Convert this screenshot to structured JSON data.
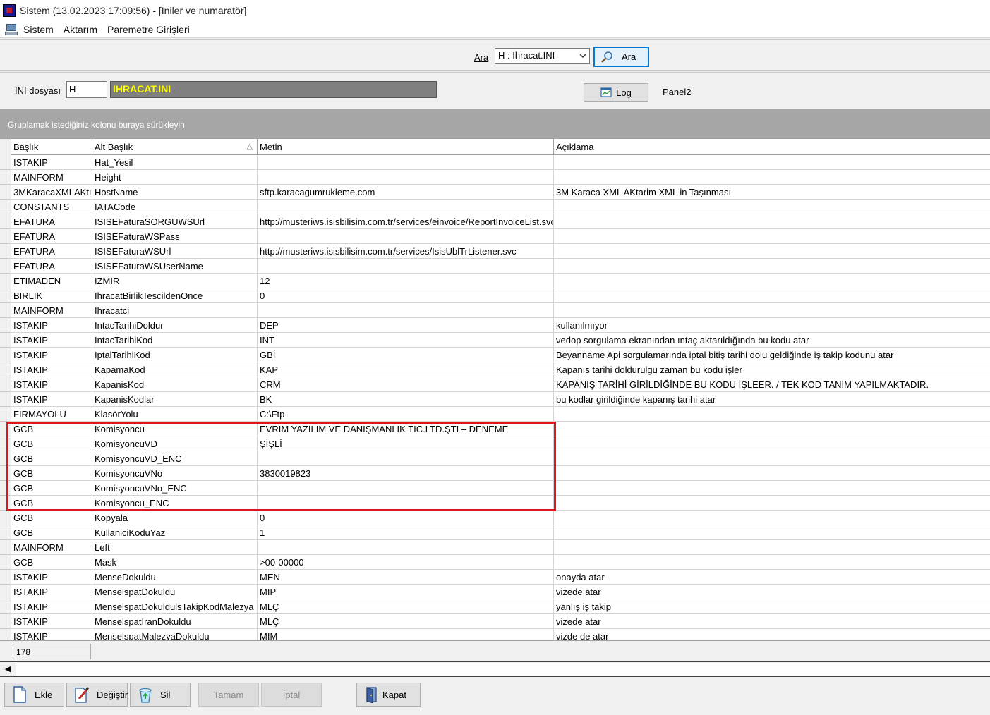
{
  "window": {
    "title": "Sistem (13.02.2023 17:09:56) - [İniler ve numaratör]"
  },
  "menu": {
    "items": [
      "Sistem",
      "Aktarım",
      "Paremetre Girişleri"
    ]
  },
  "search": {
    "label": "Ara",
    "combo_value": "H : İhracat.INI",
    "button_label": "Ara"
  },
  "ini": {
    "label": "INI dosyası",
    "code": "H",
    "filename": "IHRACAT.INI",
    "log_label": "Log",
    "panel_label": "Panel2"
  },
  "grid": {
    "group_hint": "Gruplamak istediğiniz kolonu buraya sürükleyin",
    "columns": [
      "Başlık",
      "Alt Başlık",
      "Metin",
      "Açıklama"
    ],
    "sort_indicator": "△",
    "rows": [
      [
        "ISTAKIP",
        "Hat_Yesil",
        "",
        ""
      ],
      [
        "MAINFORM",
        "Height",
        "",
        ""
      ],
      [
        "3MKaracaXMLAKtı",
        "HostName",
        "sftp.karacagumrukleme.com",
        "3M Karaca XML AKtarim XML in Taşınması"
      ],
      [
        "CONSTANTS",
        "IATACode",
        "",
        ""
      ],
      [
        "EFATURA",
        "ISISEFaturaSORGUWSUrl",
        "http://musteriws.isisbilisim.com.tr/services/einvoice/ReportInvoiceList.svc",
        ""
      ],
      [
        "EFATURA",
        "ISISEFaturaWSPass",
        "",
        ""
      ],
      [
        "EFATURA",
        "ISISEFaturaWSUrl",
        "http://musteriws.isisbilisim.com.tr/services/IsisUblTrListener.svc",
        ""
      ],
      [
        "EFATURA",
        "ISISEFaturaWSUserName",
        "",
        ""
      ],
      [
        "ETIMADEN",
        "IZMIR",
        "12",
        ""
      ],
      [
        "BIRLIK",
        "IhracatBirlikTescildenOnce",
        "0",
        ""
      ],
      [
        "MAINFORM",
        "Ihracatci",
        "",
        ""
      ],
      [
        "ISTAKIP",
        "IntacTarihiDoldur",
        "DEP",
        "kullanılmıyor"
      ],
      [
        "ISTAKIP",
        "IntacTarihiKod",
        "INT",
        "vedop sorgulama ekranından ıntaç aktarıldığında bu kodu atar"
      ],
      [
        "ISTAKIP",
        "IptalTarihiKod",
        "GBİ",
        "Beyanname Api sorgulamarında iptal bitiş tarihi dolu geldiğinde iş takip kodunu atar"
      ],
      [
        "ISTAKIP",
        "KapamaKod",
        "KAP",
        "Kapanıs tarihi doldurulgu zaman bu kodu işler"
      ],
      [
        "ISTAKIP",
        "KapanisKod",
        "CRM",
        "KAPANIŞ TARİHİ GİRİLDİĞİNDE BU KODU İŞLEER. / TEK KOD TANIM YAPILMAKTADIR."
      ],
      [
        "ISTAKIP",
        "KapanisKodlar",
        "BK",
        "bu kodlar girildiğinde kapanış tarihi atar"
      ],
      [
        "FIRMAYOLU",
        "KlasörYolu",
        "C:\\Ftp",
        ""
      ],
      [
        "GCB",
        "Komisyoncu",
        "EVRIM YAZILIM VE DANIŞMANLIK TIC.LTD.ŞTI – DENEME",
        ""
      ],
      [
        "GCB",
        "KomisyoncuVD",
        "ŞİŞLİ",
        ""
      ],
      [
        "GCB",
        "KomisyoncuVD_ENC",
        "",
        ""
      ],
      [
        "GCB",
        "KomisyoncuVNo",
        "3830019823",
        ""
      ],
      [
        "GCB",
        "KomisyoncuVNo_ENC",
        "",
        ""
      ],
      [
        "GCB",
        "Komisyoncu_ENC",
        "",
        ""
      ],
      [
        "GCB",
        "Kopyala",
        "0",
        ""
      ],
      [
        "GCB",
        "KullaniciKoduYaz",
        "1",
        ""
      ],
      [
        "MAINFORM",
        "Left",
        "",
        ""
      ],
      [
        "GCB",
        "Mask",
        ">00-00000",
        ""
      ],
      [
        "ISTAKIP",
        "MenseDokuldu",
        "MEN",
        "onayda atar"
      ],
      [
        "ISTAKIP",
        "MenselspatDokuldu",
        "MIP",
        "vizede atar"
      ],
      [
        "ISTAKIP",
        "MenselspatDokuldulsTakipKodMalezya",
        "MLÇ",
        "yanlış iş takip"
      ],
      [
        "ISTAKIP",
        "MenselspatIranDokuldu",
        "MLÇ",
        "vizede atar"
      ],
      [
        "ISTAKIP",
        "MenselspatMalezyaDokuldu",
        "MIM",
        "vizde de atar"
      ]
    ],
    "record_count": "178"
  },
  "buttons": {
    "add": "Ekle",
    "edit": "Değiştir",
    "delete": "Sil",
    "ok": "Tamam",
    "cancel": "İptal",
    "close": "Kapat"
  },
  "colors": {
    "highlight_border": "#e0151c",
    "filename_text": "#ffff00",
    "filename_bg": "#808080",
    "group_bar": "#a6a6a6"
  }
}
